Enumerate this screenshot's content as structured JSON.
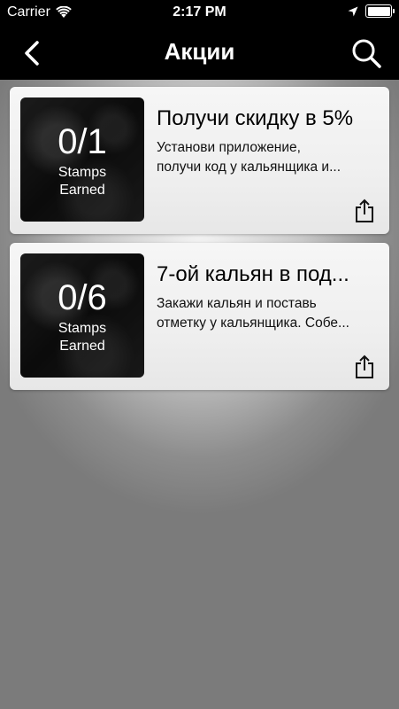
{
  "status": {
    "carrier": "Carrier",
    "time": "2:17 PM"
  },
  "nav": {
    "title": "Акции"
  },
  "promos": [
    {
      "count": "0/1",
      "label_line1": "Stamps",
      "label_line2": "Earned",
      "title": "Получи скидку в 5%",
      "desc_line1": "Установи приложение,",
      "desc_line2": "получи код у кальянщика и..."
    },
    {
      "count": "0/6",
      "label_line1": "Stamps",
      "label_line2": "Earned",
      "title": "7-ой кальян в под...",
      "desc_line1": "Закажи кальян и поставь",
      "desc_line2": "отметку у кальянщика. Собе..."
    }
  ],
  "icons": {
    "back": "chevron-left-icon",
    "search": "search-icon",
    "share": "share-icon",
    "wifi": "wifi-icon",
    "location": "location-arrow-icon",
    "battery": "battery-icon"
  }
}
